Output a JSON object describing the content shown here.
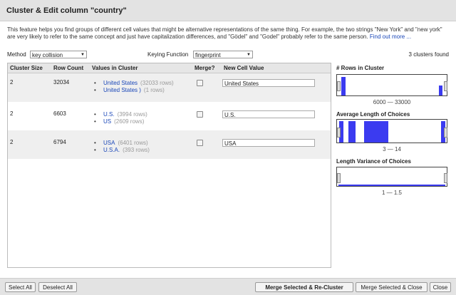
{
  "dialog": {
    "title": "Cluster & Edit column \"country\""
  },
  "description": {
    "text": "This feature helps you find groups of different cell values that might be alternative representations of the same thing. For example, the two strings \"New York\" and \"new york\" are very likely to refer to the same concept and just have capitalization differences, and \"Gödel\" and \"Godel\" probably refer to the same person.",
    "link": "Find out more ..."
  },
  "controls": {
    "method_label": "Method",
    "method_value": "key collision",
    "keying_label": "Keying Function",
    "keying_value": "fingerprint",
    "clusters_found": "3 clusters found"
  },
  "table": {
    "headers": [
      "Cluster Size",
      "Row Count",
      "Values in Cluster",
      "Merge?",
      "New Cell Value"
    ],
    "rows": [
      {
        "size": "2",
        "count": "32034",
        "values": [
          {
            "v": "United States",
            "rc": "(32033 rows)"
          },
          {
            "v": "United States )",
            "rc": "(1 rows)"
          }
        ],
        "merge": false,
        "new_value": "United States"
      },
      {
        "size": "2",
        "count": "6603",
        "values": [
          {
            "v": "U.S.",
            "rc": "(3994 rows)"
          },
          {
            "v": "US",
            "rc": "(2609 rows)"
          }
        ],
        "merge": false,
        "new_value": "U.S."
      },
      {
        "size": "2",
        "count": "6794",
        "values": [
          {
            "v": "USA",
            "rc": "(6401 rows)"
          },
          {
            "v": "U.S.A.",
            "rc": "(393 rows)"
          }
        ],
        "merge": false,
        "new_value": "USA"
      }
    ]
  },
  "facets": [
    {
      "title": "# Rows in Cluster",
      "range": "6000 — 33000"
    },
    {
      "title": "Average Length of Choices",
      "range": "3 — 14"
    },
    {
      "title": "Length Variance of Choices",
      "range": "1 — 1.5"
    }
  ],
  "footer": {
    "select_all": "Select All",
    "deselect_all": "Deselect All",
    "merge_recluster": "Merge Selected & Re-Cluster",
    "merge_close": "Merge Selected & Close",
    "close": "Close"
  },
  "colors": {
    "accent": "#1a47b8",
    "histogram": "#3b3bf0"
  }
}
